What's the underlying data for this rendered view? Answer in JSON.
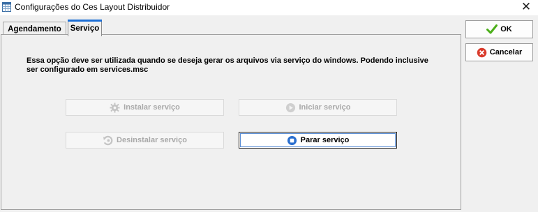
{
  "window": {
    "title": "Configurações do Ces Layout Distribuidor",
    "icon": "app-grid-icon",
    "close_glyph": "✕"
  },
  "tabs": [
    {
      "label": "Agendamento",
      "active": false
    },
    {
      "label": "Serviço",
      "active": true
    }
  ],
  "servico": {
    "description": "Essa opção deve ser utilizada quando se deseja gerar os arquivos via serviço do windows. Podendo inclusive ser configurado em services.msc",
    "buttons": {
      "instalar": {
        "label": "Instalar serviço",
        "enabled": false,
        "icon": "gear-icon"
      },
      "iniciar": {
        "label": "Iniciar serviço",
        "enabled": false,
        "icon": "play-icon"
      },
      "desinstalar": {
        "label": "Desinstalar serviço",
        "enabled": false,
        "icon": "uninstall-icon"
      },
      "parar": {
        "label": "Parar serviço",
        "enabled": true,
        "icon": "stop-icon"
      }
    }
  },
  "actions": {
    "ok_label": "OK",
    "cancel_label": "Cancelar"
  },
  "colors": {
    "accent": "#1c6fd6",
    "ok_check": "#4caf1a",
    "cancel_red": "#d93a2b",
    "stop_blue": "#2a6fd0",
    "disabled_text": "#a9a9a9"
  }
}
